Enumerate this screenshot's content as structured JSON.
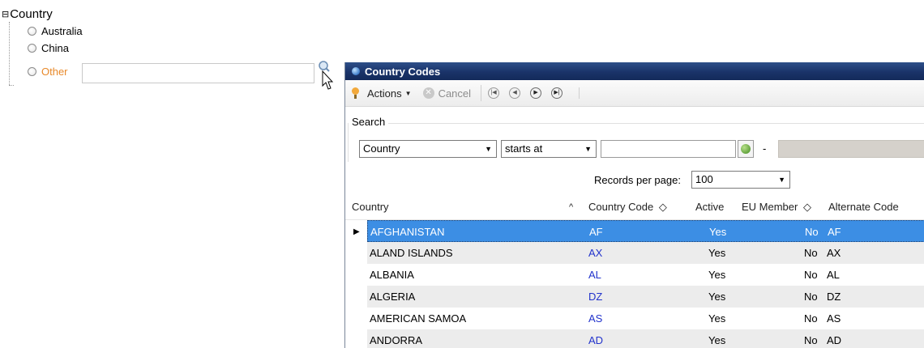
{
  "form": {
    "group_label": "Country",
    "collapse_glyph": "⊟",
    "options": [
      {
        "label": "Australia"
      },
      {
        "label": "China"
      },
      {
        "label": "Other"
      }
    ],
    "other_value": ""
  },
  "dialog": {
    "title": "Country Codes",
    "toolbar": {
      "actions_label": "Actions",
      "cancel_label": "Cancel",
      "nav": [
        "first-icon",
        "previous-icon",
        "next-icon",
        "last-icon"
      ]
    },
    "search": {
      "legend": "Search",
      "field": "Country",
      "operator": "starts at",
      "value": "",
      "dash": "-",
      "to_value": ""
    },
    "records_per_page_label": "Records per page:",
    "records_per_page": "100",
    "columns": [
      "Country",
      "Country Code",
      "Active",
      "EU Member",
      "Alternate Code"
    ],
    "sort_indicator": "^",
    "sortable_glyph": "◇",
    "rows": [
      {
        "country": "AFGHANISTAN",
        "code": "AF",
        "active": "Yes",
        "eu": "No",
        "alt": "AF"
      },
      {
        "country": "ALAND ISLANDS",
        "code": "AX",
        "active": "Yes",
        "eu": "No",
        "alt": "AX"
      },
      {
        "country": "ALBANIA",
        "code": "AL",
        "active": "Yes",
        "eu": "No",
        "alt": "AL"
      },
      {
        "country": "ALGERIA",
        "code": "DZ",
        "active": "Yes",
        "eu": "No",
        "alt": "DZ"
      },
      {
        "country": "AMERICAN SAMOA",
        "code": "AS",
        "active": "Yes",
        "eu": "No",
        "alt": "AS"
      },
      {
        "country": "ANDORRA",
        "code": "AD",
        "active": "Yes",
        "eu": "No",
        "alt": "AD"
      }
    ],
    "selected_row": 0
  },
  "colors": {
    "other_label": "#e8892a",
    "title_bar": "#1a3369",
    "selection": "#3c8ee4",
    "code_text": "#2233cc"
  }
}
